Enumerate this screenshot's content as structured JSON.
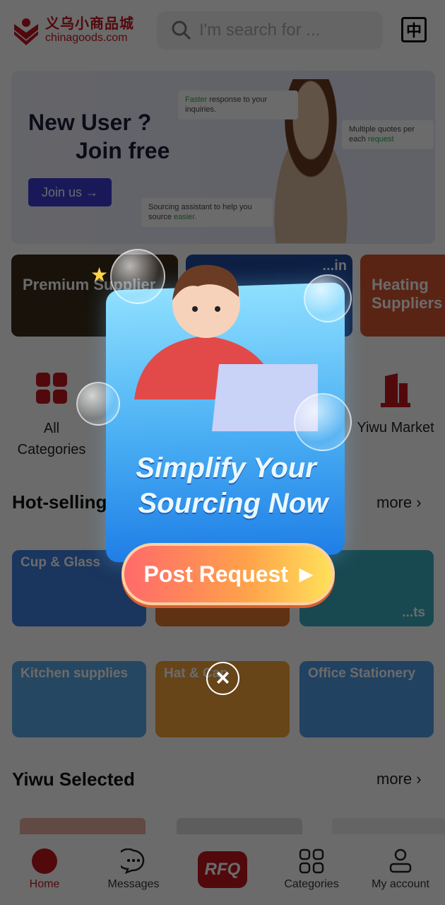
{
  "header": {
    "logo_cn": "义乌小商品城",
    "logo_en": "chinagoods.com",
    "search_placeholder": "I'm search for ...",
    "language_button": "中"
  },
  "banner": {
    "title_line1": "New User ?",
    "title_line2": "Join free",
    "cta": "Join us →",
    "feature1_highlight": "Faster",
    "feature1_rest": " response to your inquiries.",
    "feature2": "Multiple quotes per each ",
    "feature2_highlight": "request",
    "feature3": "Sourcing assistant to help you source ",
    "feature3_highlight": "easier."
  },
  "promo_cards": [
    {
      "label": "Premium Supplier",
      "color": "#3a2a1a"
    },
    {
      "label": "...in",
      "color": "#1e4aa0"
    },
    {
      "label": "Heating Suppliers",
      "color": "#d7552f"
    }
  ],
  "quick_icons": [
    {
      "label": "All Categories",
      "icon": "grid-icon"
    },
    {
      "label": "Yiwu Market",
      "icon": "building-icon"
    }
  ],
  "hot_selling": {
    "title": "Hot-selling",
    "more": "more",
    "tiles": [
      {
        "label": "Cup & Glass",
        "color": "#3f7fe0"
      },
      {
        "label": "",
        "color": "#e0782e"
      },
      {
        "label": "...ts",
        "color": "#3aaec0"
      },
      {
        "label": "Kitchen supplies",
        "color": "#5aa8e8"
      },
      {
        "label": "Hat & Cap",
        "color": "#f6a53a"
      },
      {
        "label": "Office Stationery",
        "color": "#4e9ce6"
      }
    ]
  },
  "yiwu_selected": {
    "title": "Yiwu Selected",
    "more": "more"
  },
  "bottom_nav": [
    {
      "label": "Home",
      "icon": "home-logo-icon",
      "active": true
    },
    {
      "label": "Messages",
      "icon": "chat-bubble-icon"
    },
    {
      "label": "RFQ",
      "icon": "rfq-icon"
    },
    {
      "label": "Categories",
      "icon": "four-squares-icon"
    },
    {
      "label": "My account",
      "icon": "person-icon"
    }
  ],
  "popup": {
    "line1": "Simplify Your",
    "line2": "Sourcing Now",
    "button": "Post Request",
    "close": "×"
  },
  "colors": {
    "brand_red": "#c4161c",
    "join_blue": "#3b3bd6"
  }
}
